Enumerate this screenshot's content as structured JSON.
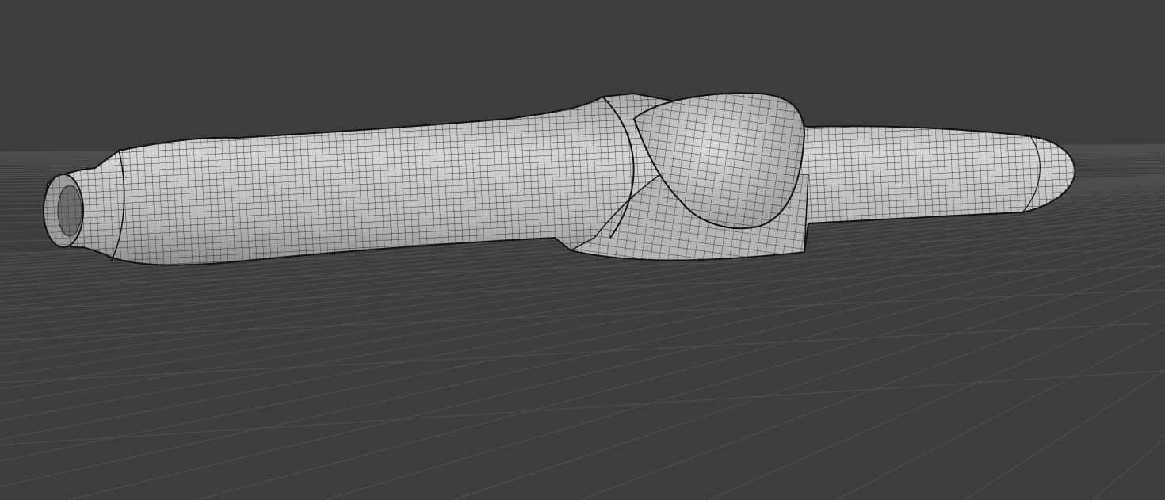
{
  "viewport": {
    "background": "#3d3d3d",
    "grid_color": "#4f4f4f",
    "mesh_fill_light": "#c9c9c9",
    "mesh_fill_dark": "#8a8a8a",
    "wire_color": "#1a1a1a"
  }
}
